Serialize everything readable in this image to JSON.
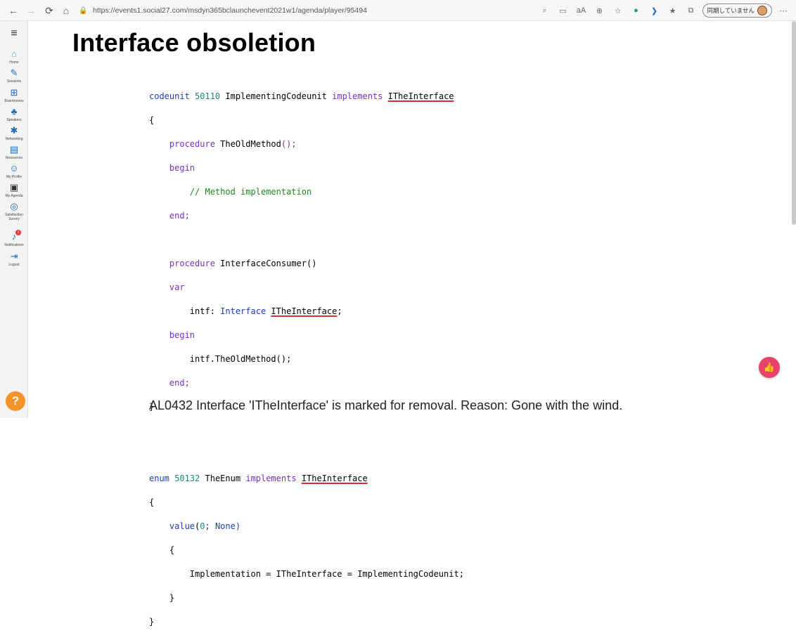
{
  "browser": {
    "url": "https://events1.social27.com/msdyn365bclaunchevent2021w1/agenda/player/95494",
    "sync_label": "同期していません"
  },
  "sidebar": {
    "items": [
      {
        "label": "Home",
        "icon": "home-icon"
      },
      {
        "label": "Sessions",
        "icon": "pen-icon"
      },
      {
        "label": "Boardrooms",
        "icon": "boardrooms-icon"
      },
      {
        "label": "Speakers",
        "icon": "speakers-icon"
      },
      {
        "label": "Networking",
        "icon": "networking-icon"
      },
      {
        "label": "Resources",
        "icon": "resources-icon"
      },
      {
        "label": "My Profile",
        "icon": "profile-icon"
      },
      {
        "label": "My Agenda",
        "icon": "agenda-icon"
      },
      {
        "label": "Satisfaction Survey",
        "icon": "survey-icon"
      },
      {
        "label": "Notifications",
        "icon": "bell-icon",
        "badge": "1"
      },
      {
        "label": "Logout",
        "icon": "logout-icon"
      }
    ],
    "help": "?"
  },
  "slide": {
    "title": "Interface obsoletion",
    "caption": "AL0432 Interface 'ITheInterface' is marked for removal. Reason: Gone with the wind."
  },
  "code": {
    "l1_kw": "codeunit",
    "l1_num": "50110",
    "l1_name": "ImplementingCodeunit",
    "l1_impl": "implements",
    "l1_iface": "ITheInterface",
    "l2": "{",
    "l3_kw": "procedure",
    "l3_rest": "TheOldMethod",
    "l3_parens": "();",
    "l4": "begin",
    "l5": "// Method implementation",
    "l6": "end;",
    "l8_kw": "procedure",
    "l8_rest": "InterfaceConsumer()",
    "l9": "var",
    "l10_a": "intf:",
    "l10_b": "Interface",
    "l10_c": "ITheInterface",
    "l10_d": ";",
    "l11": "begin",
    "l12": "intf.TheOldMethod();",
    "l13": "end;",
    "l14": "}",
    "l17_kw": "enum",
    "l17_num": "50132",
    "l17_name": "TheEnum",
    "l17_impl": "implements",
    "l17_iface": "ITheInterface",
    "l18": "{",
    "l19_kw": "value",
    "l19_a": "(",
    "l19_num": "0",
    "l19_b": "; None)",
    "l20": "{",
    "l21": "Implementation = ITheInterface = ImplementingCodeunit;",
    "l22": "}",
    "l23": "}"
  }
}
